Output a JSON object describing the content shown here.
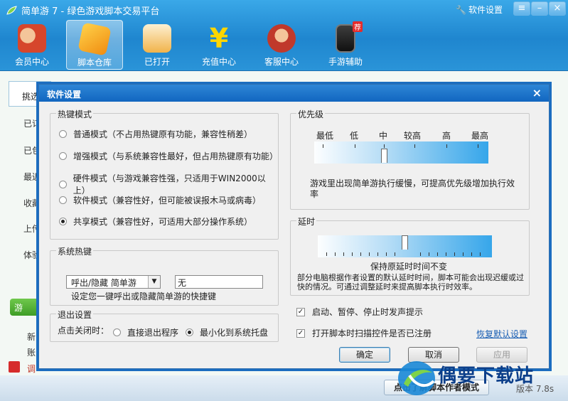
{
  "app": {
    "title": "简单游 7 - 绿色游戏脚本交易平台",
    "settings_link": "软件设置",
    "nav": [
      {
        "label": "会员中心",
        "icon": "member-icon"
      },
      {
        "label": "脚本仓库",
        "icon": "script-store-icon"
      },
      {
        "label": "已打开",
        "icon": "opened-icon"
      },
      {
        "label": "充值中心",
        "icon": "recharge-icon"
      },
      {
        "label": "客服中心",
        "icon": "support-icon"
      },
      {
        "label": "手游辅助",
        "icon": "mobile-icon",
        "badge": "荐"
      }
    ],
    "sidebar": {
      "tab": "挑选",
      "items": [
        "已订",
        "已包",
        "最近",
        "收藏",
        "上传",
        "体验"
      ],
      "green_button": "游",
      "bottom_items": [
        "新",
        "账",
        "调"
      ]
    },
    "bottom_button": "点击了解脚本作者模式",
    "version": "版本 7.8s"
  },
  "dialog": {
    "title": "软件设置",
    "hotkey_mode": {
      "title": "热键模式",
      "options": [
        "普通模式（不占用热键原有功能，兼容性稍差）",
        "增强模式（与系统兼容性最好，但占用热键原有功能）",
        "硬件模式（与游戏兼容性强，只适用于WIN2000以上）",
        "软件模式（兼容性好，但可能被误报木马或病毒）",
        "共享模式（兼容性好，可适用大部分操作系统）"
      ],
      "selected_index": 4
    },
    "system_hotkey": {
      "title": "系统热键",
      "select_value": "呼出/隐藏 简单游",
      "input_value": "无",
      "hint": "设定您一键呼出或隐藏简单游的快捷键"
    },
    "exit_settings": {
      "title": "退出设置",
      "label": "点击关闭时：",
      "options": [
        "直接退出程序",
        "最小化到系统托盘"
      ],
      "selected_index": 1
    },
    "priority": {
      "title": "优先级",
      "levels": [
        "最低",
        "低",
        "中",
        "较高",
        "高",
        "最高"
      ],
      "selected_level": "中",
      "note": "游戏里出现简单游执行缓慢，可提高优先级增加执行效率"
    },
    "delay": {
      "title": "延时",
      "status": "保持原延时时间不变",
      "note": "部分电脑根据作者设置的默认延时时间，脚本可能会出现迟缓或过快的情况。可通过调整延时来提高脚本执行时效率。"
    },
    "checks": [
      {
        "label": "启动、暂停、停止时发声提示",
        "checked": true
      },
      {
        "label": "打开脚本时扫描控件是否已注册",
        "checked": true
      }
    ],
    "restore_link": "恢复默认设置",
    "buttons": {
      "ok": "确定",
      "cancel": "取消",
      "apply": "应用"
    }
  },
  "watermark": {
    "text": "偶要下载站"
  },
  "colors": {
    "topbar": "#1f86cf",
    "dialog_title": "#1166c0",
    "link": "#1a5fb4"
  }
}
